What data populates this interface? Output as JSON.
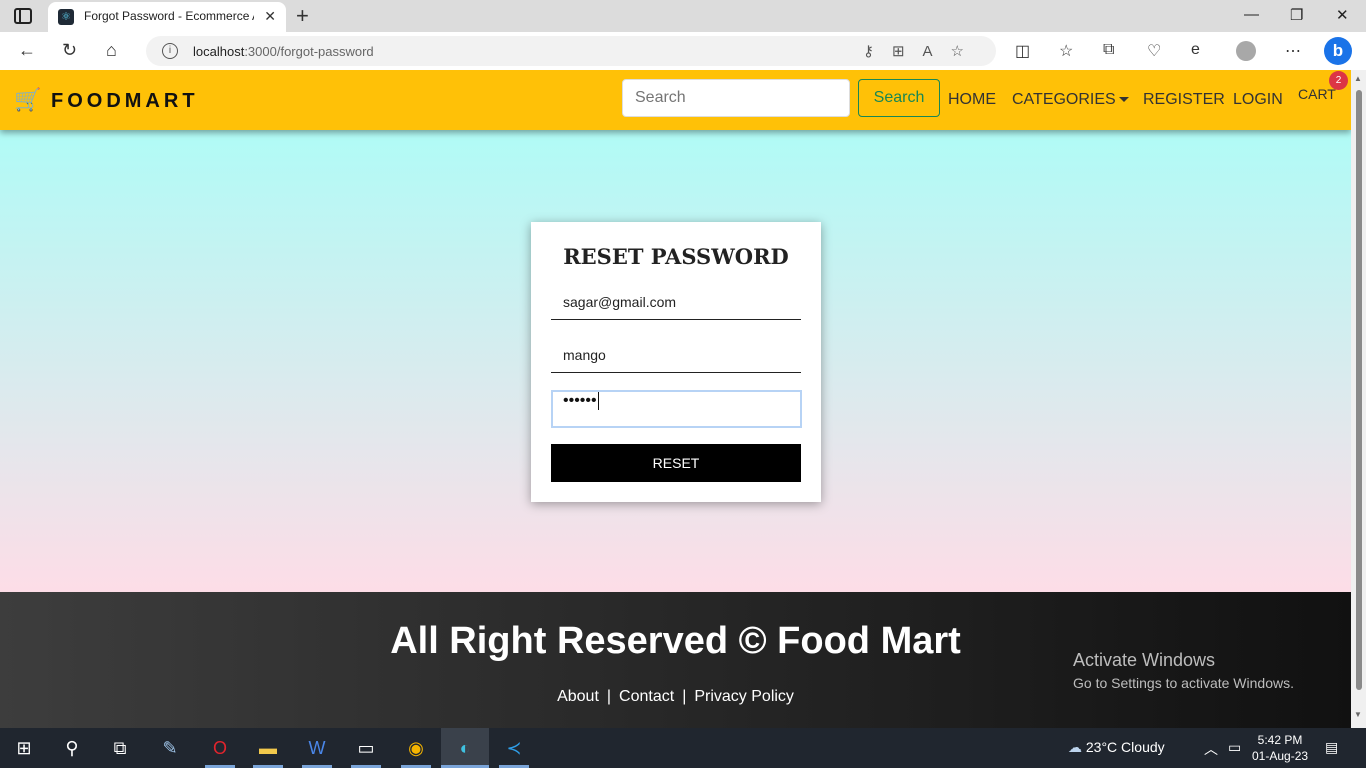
{
  "browser": {
    "tab_title": "Forgot Password - Ecommerce A",
    "tab_close": "✕",
    "new_tab": "+",
    "url_host": "localhost",
    "url_rest": ":3000/forgot-password"
  },
  "navbar": {
    "brand": "FOODMART",
    "search_placeholder": "Search",
    "search_button": "Search",
    "links": {
      "home": "HOME",
      "categories": "CATEGORIES",
      "register": "REGISTER",
      "login": "LOGIN",
      "cart": "CART"
    },
    "cart_count": "2"
  },
  "form": {
    "title": "RESET PASSWORD",
    "email_value": "sagar@gmail.com",
    "answer_value": "mango",
    "password_masked": "••••••",
    "submit_label": "RESET"
  },
  "footer": {
    "title": "All Right Reserved © Food Mart",
    "links": [
      "About",
      "Contact",
      "Privacy Policy"
    ],
    "separator": "|"
  },
  "watermark": {
    "line1": "Activate Windows",
    "line2": "Go to Settings to activate Windows."
  },
  "taskbar": {
    "weather": "23°C  Cloudy",
    "time": "5:42 PM",
    "date": "01-Aug-23"
  },
  "colors": {
    "navbar": "#ffc107",
    "search_button": "#198754",
    "badge": "#dc3545",
    "gradient_top": "#b0fbf6",
    "gradient_bottom": "#fddde7"
  }
}
